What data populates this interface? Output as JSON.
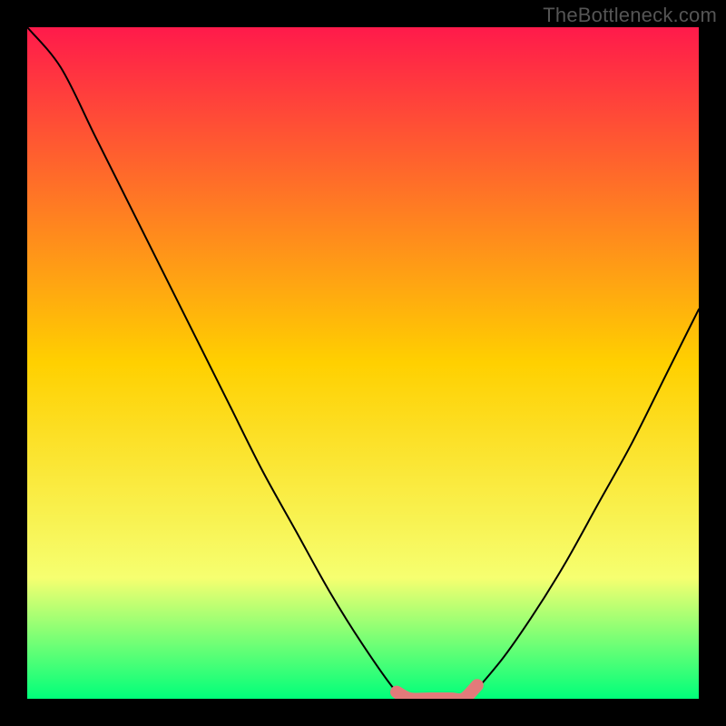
{
  "watermark": "TheBottleneck.com",
  "colors": {
    "frame": "#000000",
    "gradient_top": "#ff1a4b",
    "gradient_mid": "#ffd000",
    "gradient_lower": "#f6ff70",
    "gradient_bottom": "#00ff7a",
    "curve_main": "#000000",
    "curve_mark": "#e37a7a"
  },
  "chart_data": {
    "type": "line",
    "title": "",
    "xlabel": "",
    "ylabel": "",
    "xlim": [
      0,
      100
    ],
    "ylim": [
      0,
      100
    ],
    "series": [
      {
        "name": "bottleneck-curve",
        "x": [
          0,
          5,
          10,
          15,
          20,
          25,
          30,
          35,
          40,
          45,
          50,
          55,
          57,
          60,
          65,
          70,
          75,
          80,
          85,
          90,
          95,
          100
        ],
        "y": [
          100,
          94,
          84,
          74,
          64,
          54,
          44,
          34,
          25,
          16,
          8,
          1,
          0,
          0,
          0,
          5,
          12,
          20,
          29,
          38,
          48,
          58
        ]
      },
      {
        "name": "optimal-band",
        "x": [
          55,
          57,
          60,
          63,
          65,
          67
        ],
        "y": [
          1,
          0,
          0,
          0,
          0,
          2
        ]
      }
    ]
  }
}
